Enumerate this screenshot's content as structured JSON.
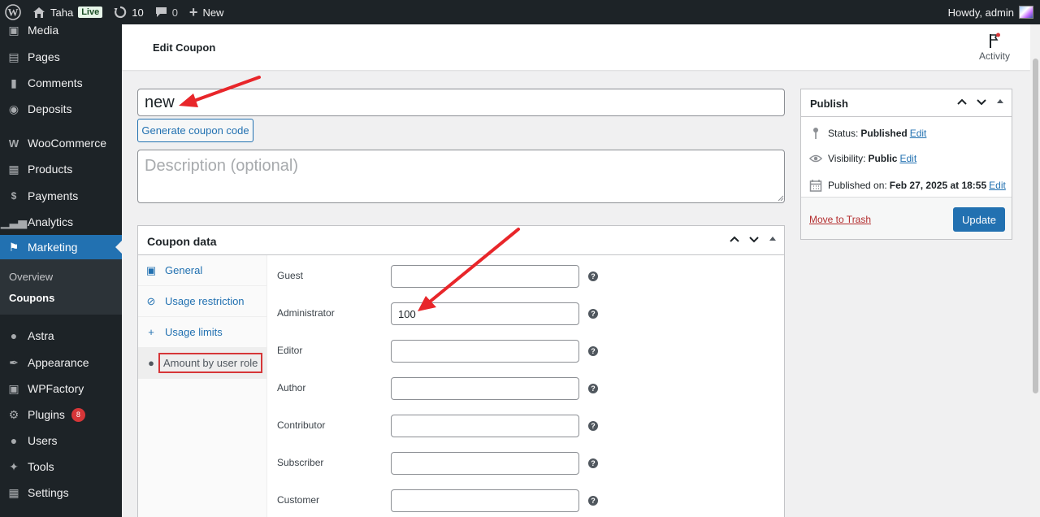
{
  "adminbar": {
    "site_name": "Taha",
    "live_badge": "Live",
    "updates_count": "10",
    "comments_count": "0",
    "new_label": "New",
    "howdy": "Howdy, admin"
  },
  "sidebar": {
    "items": [
      {
        "label": "Media",
        "icon": "media-icon"
      },
      {
        "label": "Pages",
        "icon": "pages-icon"
      },
      {
        "label": "Comments",
        "icon": "comments-icon"
      },
      {
        "label": "Deposits",
        "icon": "deposits-icon"
      },
      {
        "label": "WooCommerce",
        "icon": "woocommerce-icon"
      },
      {
        "label": "Products",
        "icon": "products-icon"
      },
      {
        "label": "Payments",
        "icon": "payments-icon"
      },
      {
        "label": "Analytics",
        "icon": "analytics-icon"
      },
      {
        "label": "Marketing",
        "icon": "marketing-icon"
      },
      {
        "label": "Astra",
        "icon": "astra-icon"
      },
      {
        "label": "Appearance",
        "icon": "appearance-icon"
      },
      {
        "label": "WPFactory",
        "icon": "wpfactory-icon"
      },
      {
        "label": "Plugins",
        "icon": "plugins-icon",
        "badge": "8"
      },
      {
        "label": "Users",
        "icon": "users-icon"
      },
      {
        "label": "Tools",
        "icon": "tools-icon"
      },
      {
        "label": "Settings",
        "icon": "settings-icon"
      }
    ],
    "submenu": [
      {
        "label": "Overview"
      },
      {
        "label": "Coupons"
      }
    ]
  },
  "header": {
    "title": "Edit Coupon",
    "activity_label": "Activity"
  },
  "coupon": {
    "title_value": "new",
    "generate_label": "Generate coupon code",
    "description_placeholder": "Description (optional)"
  },
  "coupon_data": {
    "title": "Coupon data",
    "tabs": [
      {
        "label": "General",
        "icon": "ticket-icon"
      },
      {
        "label": "Usage restriction",
        "icon": "restriction-icon"
      },
      {
        "label": "Usage limits",
        "icon": "limits-icon"
      },
      {
        "label": "Amount by user role",
        "icon": "user-icon"
      }
    ],
    "roles": [
      {
        "label": "Guest",
        "value": ""
      },
      {
        "label": "Administrator",
        "value": "100"
      },
      {
        "label": "Editor",
        "value": ""
      },
      {
        "label": "Author",
        "value": ""
      },
      {
        "label": "Contributor",
        "value": ""
      },
      {
        "label": "Subscriber",
        "value": ""
      },
      {
        "label": "Customer",
        "value": ""
      }
    ],
    "help_glyph": "?"
  },
  "publish": {
    "title": "Publish",
    "status_label": "Status:",
    "status_value": "Published",
    "visibility_label": "Visibility:",
    "visibility_value": "Public",
    "published_label": "Published on:",
    "published_value": "Feb 27, 2025 at 18:55",
    "edit_label": "Edit",
    "trash_label": "Move to Trash",
    "update_label": "Update"
  },
  "colors": {
    "accent": "#2271b1",
    "adminbar": "#1d2327",
    "annotation_arrow": "#e8262a",
    "highlight_box": "#d63638"
  }
}
